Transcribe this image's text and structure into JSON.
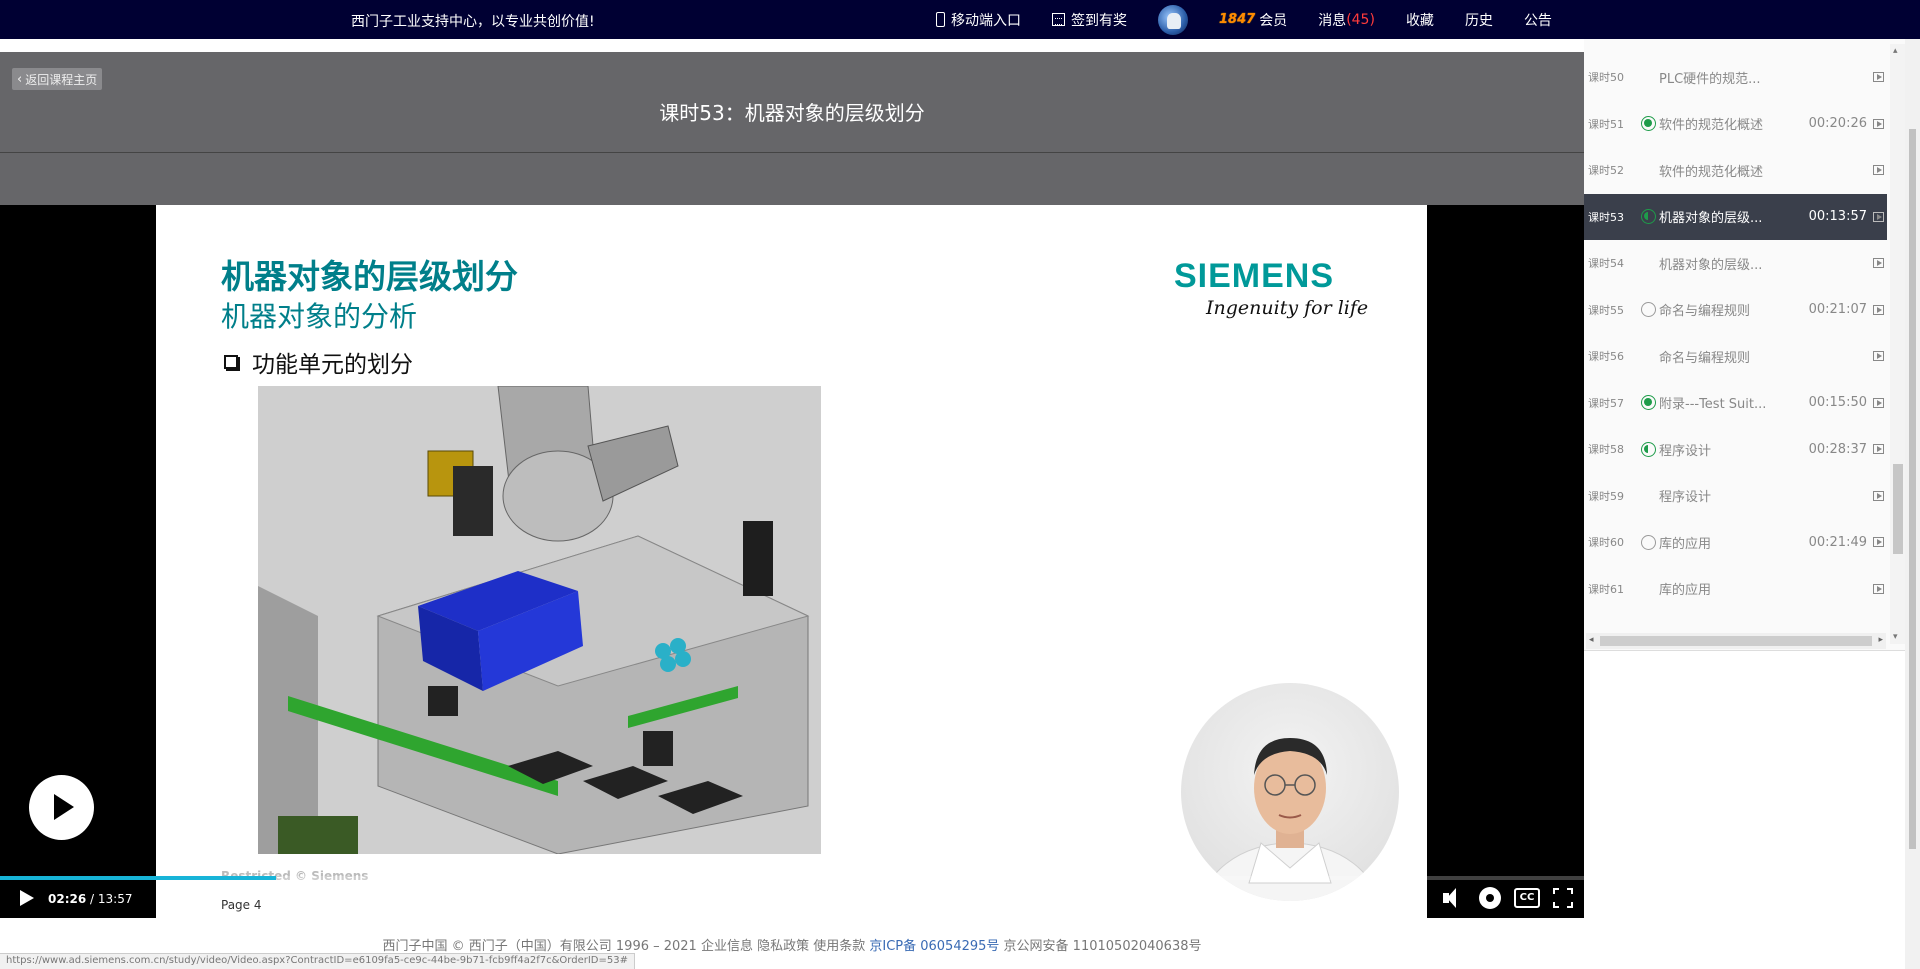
{
  "topbar": {
    "slogan": "西门子工业支持中心，以专业共创价值!",
    "nav": {
      "mobile": "移动端入口",
      "checkin": "签到有奖",
      "vip_badge": "1847",
      "member": "会员",
      "messages": "消息",
      "message_count": "(45)",
      "favorites": "收藏",
      "history": "历史",
      "notice": "公告"
    }
  },
  "player": {
    "back_label": "返回课程主页",
    "lesson_title": "课时53：机器对象的层级划分",
    "slide": {
      "heading": "机器对象的层级划分",
      "subheading": "机器对象的分析",
      "bullet": "功能单元的划分",
      "logo": "SIEMENS",
      "tagline": "Ingenuity for life",
      "restricted": "Restricted © Siemens",
      "page": "Page 4"
    },
    "controls": {
      "current_time": "02:26",
      "separator": " / ",
      "total_time": "13:57",
      "cc_label": "CC",
      "progress_fraction": 0.174
    }
  },
  "playlist": [
    {
      "num": "课时50",
      "title": "PLC硬件的规范...",
      "duration": "",
      "status": "none"
    },
    {
      "num": "课时51",
      "title": "软件的规范化概述",
      "duration": "00:20:26",
      "status": "done"
    },
    {
      "num": "课时52",
      "title": "软件的规范化概述",
      "duration": "",
      "status": "none"
    },
    {
      "num": "课时53",
      "title": "机器对象的层级...",
      "duration": "00:13:57",
      "status": "half",
      "active": true
    },
    {
      "num": "课时54",
      "title": "机器对象的层级...",
      "duration": "",
      "status": "none"
    },
    {
      "num": "课时55",
      "title": "命名与编程规则",
      "duration": "00:21:07",
      "status": "empty"
    },
    {
      "num": "课时56",
      "title": "命名与编程规则",
      "duration": "",
      "status": "none"
    },
    {
      "num": "课时57",
      "title": "附录---Test Suit...",
      "duration": "00:15:50",
      "status": "done"
    },
    {
      "num": "课时58",
      "title": "程序设计",
      "duration": "00:28:37",
      "status": "half"
    },
    {
      "num": "课时59",
      "title": "程序设计",
      "duration": "",
      "status": "none"
    },
    {
      "num": "课时60",
      "title": "库的应用",
      "duration": "00:21:49",
      "status": "empty"
    },
    {
      "num": "课时61",
      "title": "库的应用",
      "duration": "",
      "status": "none"
    }
  ],
  "footer": {
    "copyright": "西门子中国 © 西门子（中国）有限公司 1996 – 2021 企业信息 隐私政策 使用条款 ",
    "icp": "京ICP备 06054295号",
    "psb": " 京公网安备 11010502040638号",
    "status_url": "https://www.ad.siemens.com.cn/study/video/Video.aspx?ContractID=e6109fa5-ce9c-44be-9b71-fcb9ff4a2f7c&OrderID=53#"
  },
  "colors": {
    "topbar_bg": "#000033",
    "progress": "#17b4d8",
    "siemens_teal": "#009999",
    "done_green": "#1e9c4a",
    "message_red": "#ff3b3b"
  }
}
